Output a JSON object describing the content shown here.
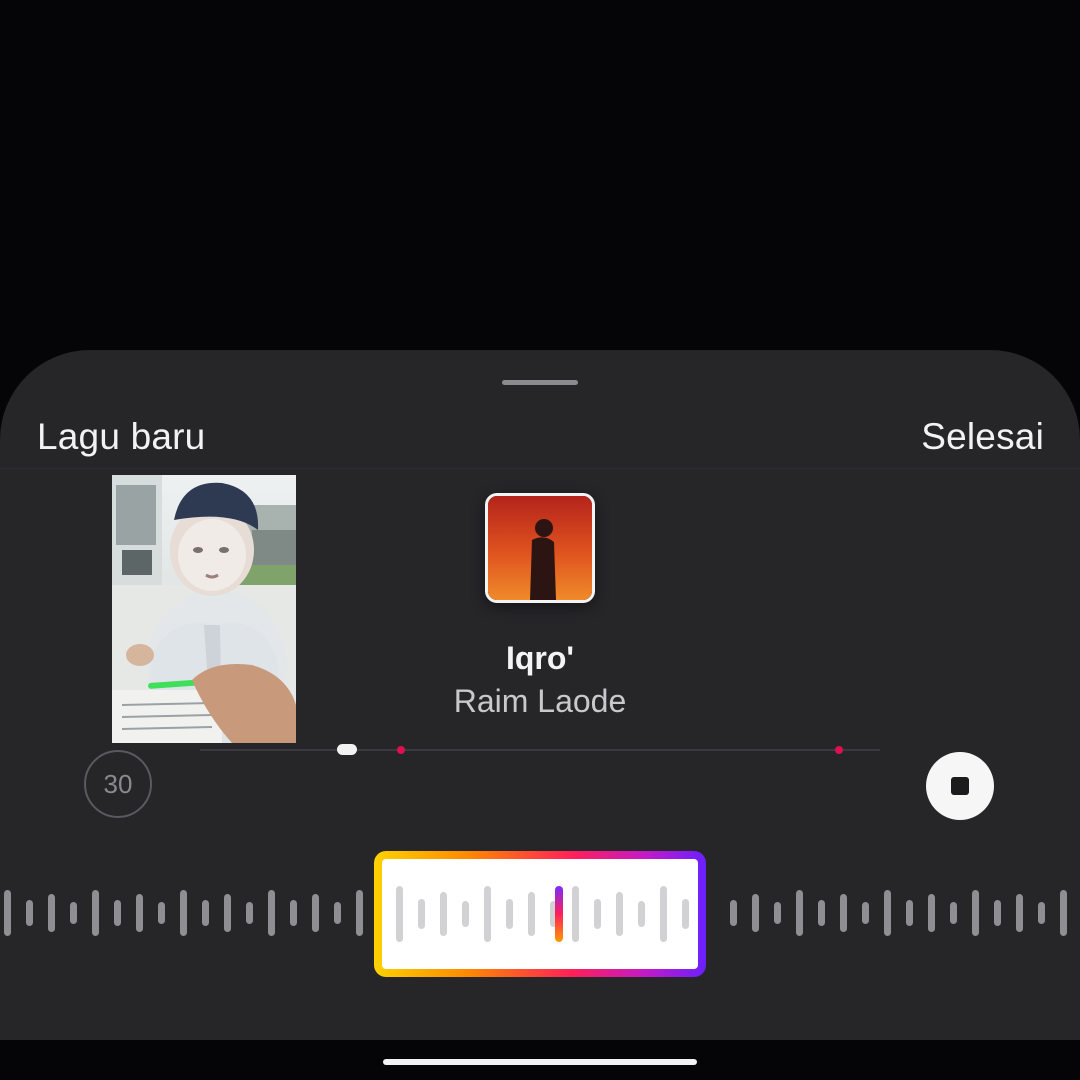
{
  "sheet": {
    "new_song_label": "Lagu baru",
    "done_label": "Selesai"
  },
  "track": {
    "title": "Iqro'",
    "artist": "Raim Laode"
  },
  "player": {
    "duration_label": "30",
    "playhead_fraction": 0.21,
    "markers_fraction": [
      0.29,
      0.94
    ]
  },
  "icons": {
    "grabber": "drag-handle-icon",
    "stop": "stop-icon"
  },
  "colors": {
    "sheet_bg": "#262629",
    "marker": "#e0104f",
    "selector_gradient": [
      "#ffd200",
      "#ff8a00",
      "#ff1f5a",
      "#c21ac9",
      "#6a20ff"
    ]
  }
}
